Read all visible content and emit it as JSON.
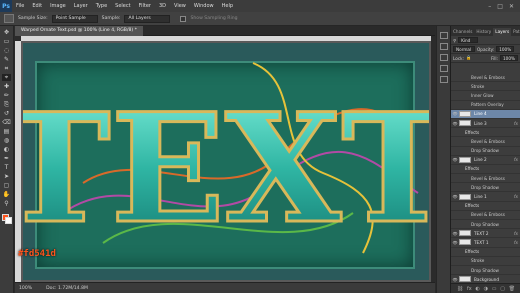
{
  "app": {
    "logo": "Ps",
    "menu": [
      "File",
      "Edit",
      "Image",
      "Layer",
      "Type",
      "Select",
      "Filter",
      "3D",
      "View",
      "Window",
      "Help"
    ],
    "window_controls": [
      "–",
      "□",
      "✕"
    ]
  },
  "options": {
    "sample_size_label": "Sample Size:",
    "sample_size_value": "Point Sample",
    "sample_label": "Sample:",
    "sample_value": "All Layers",
    "show_ring_label": "Show Sampling Ring"
  },
  "document": {
    "tab_title": "Warped Ornate Text.psd @ 100% (Line 4, RGB/8) *",
    "art_text": "TEXT"
  },
  "status": {
    "zoom": "100%",
    "doc_info": "Doc: 1.72M/14.8M"
  },
  "hex_overlay": "#fd541d",
  "colors": {
    "foreground": "#fd541d",
    "background": "#ffffff",
    "accent": "#fd541d",
    "selected_layer": "#6d87a8"
  },
  "tools": [
    "move-icon",
    "marquee-icon",
    "lasso-icon",
    "quick-select-icon",
    "crop-icon",
    "eyedropper-icon",
    "healing-icon",
    "brush-icon",
    "clone-icon",
    "history-brush-icon",
    "eraser-icon",
    "gradient-icon",
    "blur-icon",
    "dodge-icon",
    "pen-icon",
    "type-icon",
    "path-select-icon",
    "shape-icon",
    "hand-icon",
    "zoom-icon"
  ],
  "tool_glyphs": [
    "✥",
    "▭",
    "◌",
    "✎",
    "⌗",
    "⌖",
    "✚",
    "✏",
    "⎘",
    "↺",
    "⌫",
    "▤",
    "◍",
    "◐",
    "✒",
    "T",
    "➤",
    "▢",
    "✋",
    "⚲"
  ],
  "layers_panel": {
    "tabs": [
      "Channels",
      "History",
      "Layers",
      "Paths"
    ],
    "active_tab": "Layers",
    "filter": "Kind",
    "blend_mode": "Normal",
    "opacity_label": "Opacity:",
    "opacity_value": "100%",
    "lock_label": "Lock:",
    "fill_label": "Fill:",
    "fill_value": "100%",
    "rows": [
      {
        "name": "Bevel & Emboss",
        "kind": "effect"
      },
      {
        "name": "Stroke",
        "kind": "effect"
      },
      {
        "name": "Inner Glow",
        "kind": "effect"
      },
      {
        "name": "Pattern Overlay",
        "kind": "effect"
      },
      {
        "name": "Line 4",
        "kind": "layer",
        "selected": true
      },
      {
        "name": "Line 3",
        "kind": "layer",
        "fx": "fx"
      },
      {
        "name": "Effects",
        "kind": "effects"
      },
      {
        "name": "Bevel & Emboss",
        "kind": "effect"
      },
      {
        "name": "Drop Shadow",
        "kind": "effect"
      },
      {
        "name": "Line 2",
        "kind": "layer",
        "fx": "fx"
      },
      {
        "name": "Effects",
        "kind": "effects"
      },
      {
        "name": "Bevel & Emboss",
        "kind": "effect"
      },
      {
        "name": "Drop Shadow",
        "kind": "effect"
      },
      {
        "name": "Line 1",
        "kind": "layer",
        "fx": "fx"
      },
      {
        "name": "Effects",
        "kind": "effects"
      },
      {
        "name": "Bevel & Emboss",
        "kind": "effect"
      },
      {
        "name": "Drop Shadow",
        "kind": "effect"
      },
      {
        "name": "TEXT 2",
        "kind": "layer",
        "fx": "fx"
      },
      {
        "name": "TEXT 1",
        "kind": "layer",
        "fx": "fx"
      },
      {
        "name": "Effects",
        "kind": "effects"
      },
      {
        "name": "Stroke",
        "kind": "effect"
      },
      {
        "name": "Drop Shadow",
        "kind": "effect"
      },
      {
        "name": "Background",
        "kind": "layer"
      }
    ],
    "footer_icons": [
      "link-icon",
      "fx-icon",
      "mask-icon",
      "adjustment-icon",
      "folder-icon",
      "new-layer-icon",
      "trash-icon"
    ],
    "footer_glyphs": [
      "⛓",
      "fx",
      "◐",
      "◑",
      "▭",
      "▢",
      "🗑"
    ]
  },
  "right_dock_icons": [
    "color-panel-icon",
    "swatches-panel-icon",
    "adjustments-panel-icon",
    "styles-panel-icon",
    "properties-panel-icon"
  ]
}
